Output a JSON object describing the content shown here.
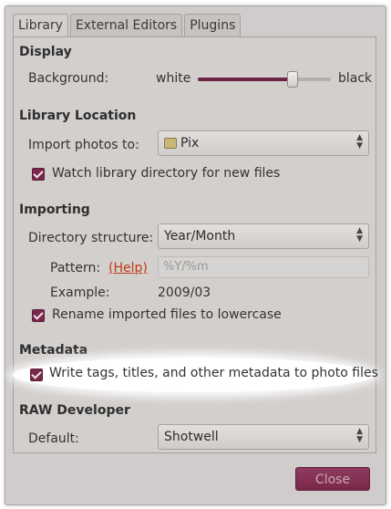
{
  "tabs": [
    {
      "label": "Library"
    },
    {
      "label": "External Editors"
    },
    {
      "label": "Plugins"
    }
  ],
  "display": {
    "heading": "Display",
    "background_label": "Background:",
    "slider_min_label": "white",
    "slider_max_label": "black",
    "slider_value": 0.73
  },
  "library_location": {
    "heading": "Library Location",
    "import_label": "Import photos to:",
    "import_value": "Pix",
    "watch_label": "Watch library directory for new files",
    "watch_checked": true
  },
  "importing": {
    "heading": "Importing",
    "dir_structure_label": "Directory structure:",
    "dir_structure_value": "Year/Month",
    "pattern_label": "Pattern:",
    "help_link": "(Help)",
    "pattern_value": "%Y/%m",
    "example_label": "Example:",
    "example_value": "2009/03",
    "rename_label": "Rename imported files to lowercase",
    "rename_checked": true
  },
  "metadata": {
    "heading": "Metadata",
    "write_label": "Write tags, titles, and other metadata to photo files",
    "write_checked": true
  },
  "raw": {
    "heading": "RAW Developer",
    "default_label": "Default:",
    "default_value": "Shotwell"
  },
  "footer": {
    "close_label": "Close"
  },
  "colors": {
    "accent": "#7a2849",
    "link": "#c23a14"
  }
}
